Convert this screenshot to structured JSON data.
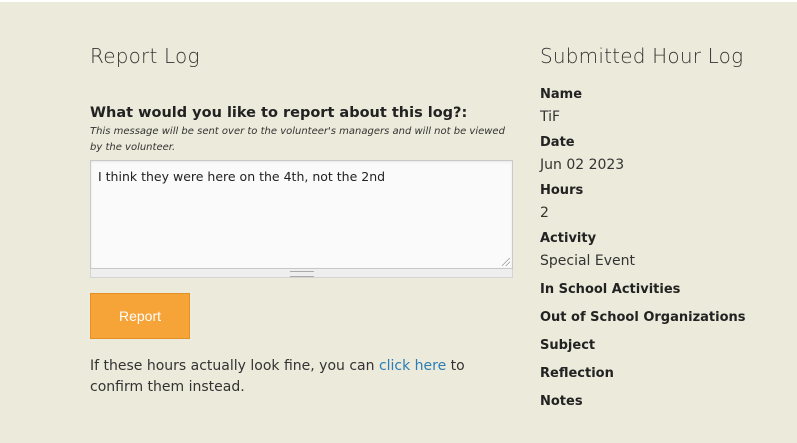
{
  "report": {
    "title": "Report Log",
    "question": "What would you like to report about this log?:",
    "note": "This message will be sent over to the volunteer's managers and will not be viewed by the volunteer.",
    "message": "I think they were here on the 4th, not the 2nd",
    "button_label": "Report",
    "confirm_prefix": "If these hours actually look fine, you can ",
    "confirm_link": "click here",
    "confirm_suffix": " to confirm them instead."
  },
  "log": {
    "title": "Submitted Hour Log",
    "name_label": "Name",
    "name_value": "TiF",
    "date_label": "Date",
    "date_value": "Jun 02 2023",
    "hours_label": "Hours",
    "hours_value": "2",
    "activity_label": "Activity",
    "activity_value": "Special Event",
    "in_school_label": "In School Activities",
    "out_school_label": "Out of School Organizations",
    "subject_label": "Subject",
    "reflection_label": "Reflection",
    "notes_label": "Notes"
  },
  "colors": {
    "background": "#eceada",
    "button": "#f6a437",
    "link": "#2a7db7"
  }
}
